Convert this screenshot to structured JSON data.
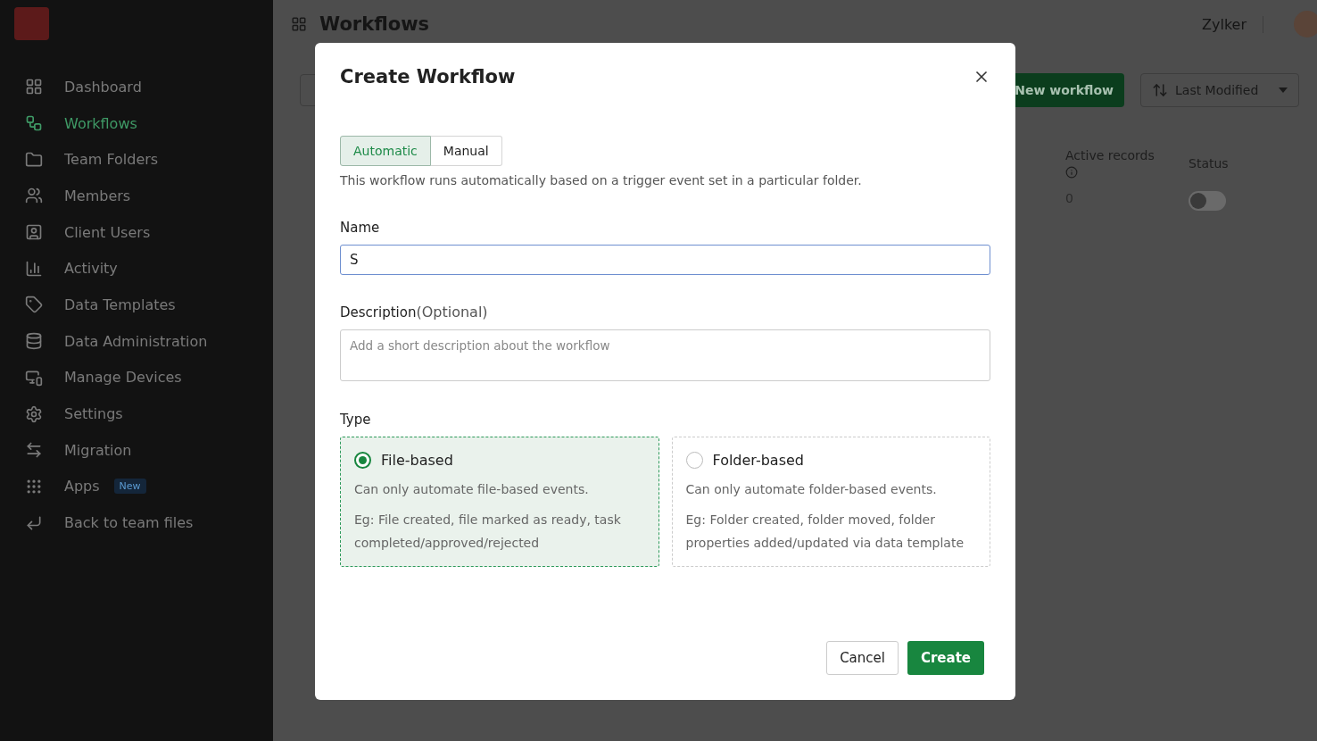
{
  "sidebar": {
    "items": [
      {
        "label": "Dashboard",
        "selected": false
      },
      {
        "label": "Workflows",
        "selected": true
      },
      {
        "label": "Team Folders",
        "selected": false
      },
      {
        "label": "Members",
        "selected": false
      },
      {
        "label": "Client Users",
        "selected": false
      },
      {
        "label": "Activity",
        "selected": false
      },
      {
        "label": "Data Templates",
        "selected": false
      },
      {
        "label": "Data Administration",
        "selected": false
      },
      {
        "label": "Manage Devices",
        "selected": false
      },
      {
        "label": "Settings",
        "selected": false
      },
      {
        "label": "Migration",
        "selected": false
      },
      {
        "label": "Apps",
        "selected": false,
        "badge": "New"
      },
      {
        "label": "Back to team files",
        "selected": false
      }
    ]
  },
  "header": {
    "title": "Workflows",
    "org": "Zylker"
  },
  "toolbar": {
    "new_button": "New workflow",
    "sort": "Last Modified"
  },
  "table": {
    "columns": [
      "Active records",
      "Status"
    ],
    "rows": [
      {
        "cells": [
          "0"
        ],
        "on": false
      }
    ]
  },
  "dialog": {
    "title": "Create Workflow",
    "modes": [
      {
        "label": "Automatic",
        "selected": true
      },
      {
        "label": "Manual",
        "selected": false
      }
    ],
    "mode_hint": "This workflow runs automatically based on a trigger event set in a particular folder.",
    "name": {
      "label": "Name",
      "value": "S"
    },
    "description": {
      "label": "Description",
      "optional": "(Optional)",
      "placeholder": "Add a short description about the workflow"
    },
    "type": {
      "label": "Type",
      "options": [
        {
          "title": "File-based",
          "selected": true,
          "summary": "Can only automate file-based events.",
          "example": "Eg: File created, file marked as ready, task completed/approved/rejected"
        },
        {
          "title": "Folder-based",
          "selected": false,
          "summary": "Can only automate folder-based events.",
          "example": "Eg: Folder created, folder moved, folder properties added/updated via data template"
        }
      ]
    },
    "buttons": {
      "cancel": "Cancel",
      "create": "Create"
    }
  }
}
